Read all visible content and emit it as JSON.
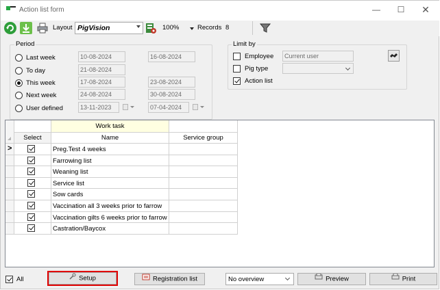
{
  "window": {
    "title": "Action list form"
  },
  "toolbar": {
    "layout_label": "Layout",
    "layout_value": "PigVision",
    "zoom_value": "100%",
    "records_label": "Records",
    "records_value": "8"
  },
  "period": {
    "title": "Period",
    "rows": [
      {
        "label": "Last week",
        "from": "10-08-2024",
        "to": "16-08-2024",
        "selected": false
      },
      {
        "label": "To day",
        "from": "21-08-2024",
        "to": "",
        "selected": false
      },
      {
        "label": "This week",
        "from": "17-08-2024",
        "to": "23-08-2024",
        "selected": true
      },
      {
        "label": "Next week",
        "from": "24-08-2024",
        "to": "30-08-2024",
        "selected": false
      },
      {
        "label": "User defined",
        "from": "13-11-2023",
        "to": "07-04-2024",
        "selected": false
      }
    ]
  },
  "limit_by": {
    "title": "Limit by",
    "employee_label": "Employee",
    "employee_placeholder": "Current user",
    "pig_type_label": "Pig type",
    "action_list_label": "Action list"
  },
  "grid": {
    "band_label": "Work task",
    "columns": {
      "select": "Select",
      "name": "Name",
      "service_group": "Service group"
    },
    "current_row_marker": ">",
    "rows": [
      {
        "name": "Preg.Test 4 weeks",
        "checked": true
      },
      {
        "name": "Farrowing list",
        "checked": true
      },
      {
        "name": "Weaning list",
        "checked": true
      },
      {
        "name": "Service list",
        "checked": true
      },
      {
        "name": "Sow cards",
        "checked": true
      },
      {
        "name": "Vaccination all 3 weeks prior to farrow",
        "checked": true
      },
      {
        "name": "Vaccination gilts 6 weeks prior to farrow",
        "checked": true
      },
      {
        "name": "Castration/Baycox",
        "checked": true
      }
    ]
  },
  "footer": {
    "all_label": "All",
    "setup_label": "Setup",
    "registration_label": "Registration list",
    "overview_value": "No overview",
    "preview_label": "Preview",
    "print_label": "Print"
  },
  "colors": {
    "accent_green": "#27a745",
    "band_yellow": "#ffffe1",
    "highlight_red": "#e00000"
  }
}
